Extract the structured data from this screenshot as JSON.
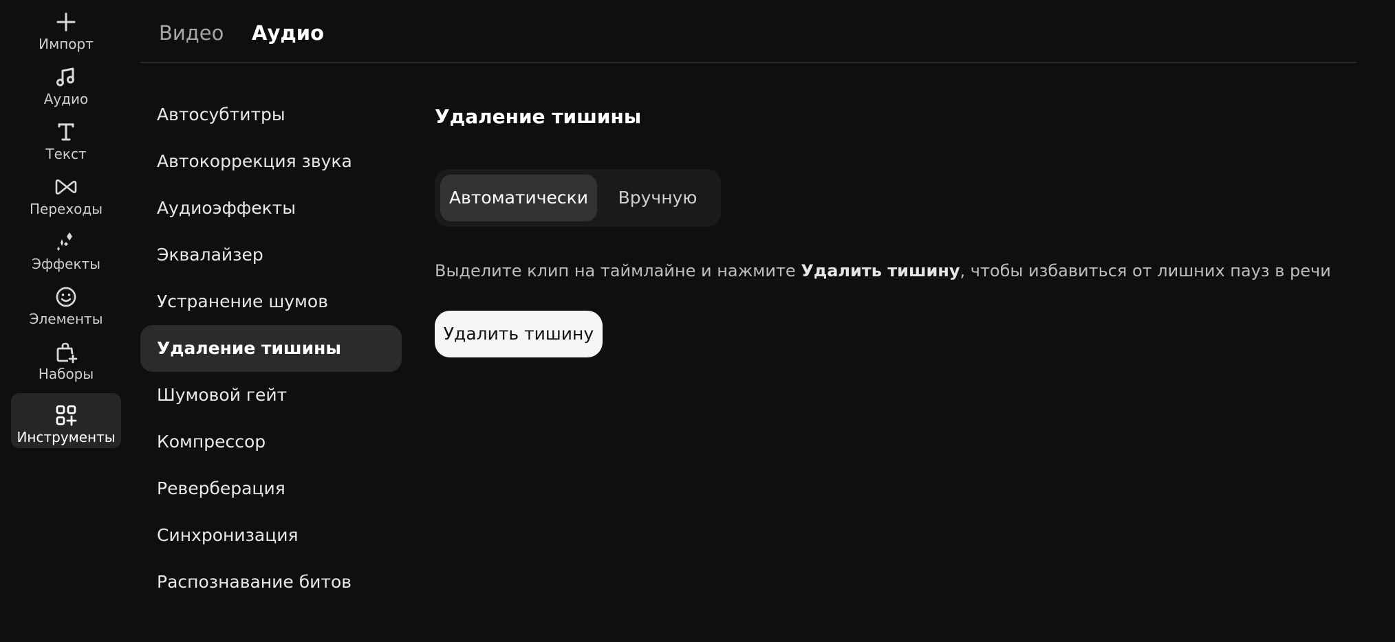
{
  "rail": {
    "items": [
      {
        "label": "Импорт",
        "icon": "plus-icon"
      },
      {
        "label": "Аудио",
        "icon": "music-note-icon"
      },
      {
        "label": "Текст",
        "icon": "text-icon"
      },
      {
        "label": "Переходы",
        "icon": "transition-icon"
      },
      {
        "label": "Эффекты",
        "icon": "sparkle-icon"
      },
      {
        "label": "Элементы",
        "icon": "smiley-icon"
      },
      {
        "label": "Наборы",
        "icon": "bag-add-icon"
      },
      {
        "label": "Инструменты",
        "icon": "grid-add-icon"
      }
    ],
    "active_index": 7
  },
  "tabs": [
    {
      "label": "Видео"
    },
    {
      "label": "Аудио"
    }
  ],
  "active_tab": "Аудио",
  "tools": {
    "items": [
      "Автосубтитры",
      "Автокоррекция звука",
      "Аудиоэффекты",
      "Эквалайзер",
      "Устранение шумов",
      "Удаление тишины",
      "Шумовой гейт",
      "Компрессор",
      "Реверберация",
      "Синхронизация",
      "Распознавание битов"
    ],
    "active_index": 5
  },
  "panel": {
    "title": "Удаление тишины",
    "mode": {
      "auto_label": "Автоматически",
      "manual_label": "Вручную",
      "selected": "Автоматически"
    },
    "description": {
      "before": "Выделите клип на таймлайне и нажмите ",
      "bold": "Удалить тишину",
      "after": ", чтобы избавиться от лишних пауз в речи"
    },
    "action_label": "Удалить тишину"
  },
  "colors": {
    "background": "#0f0f0f",
    "active_item": "#2b2b2b",
    "primary_button": "#f5f5f5"
  }
}
